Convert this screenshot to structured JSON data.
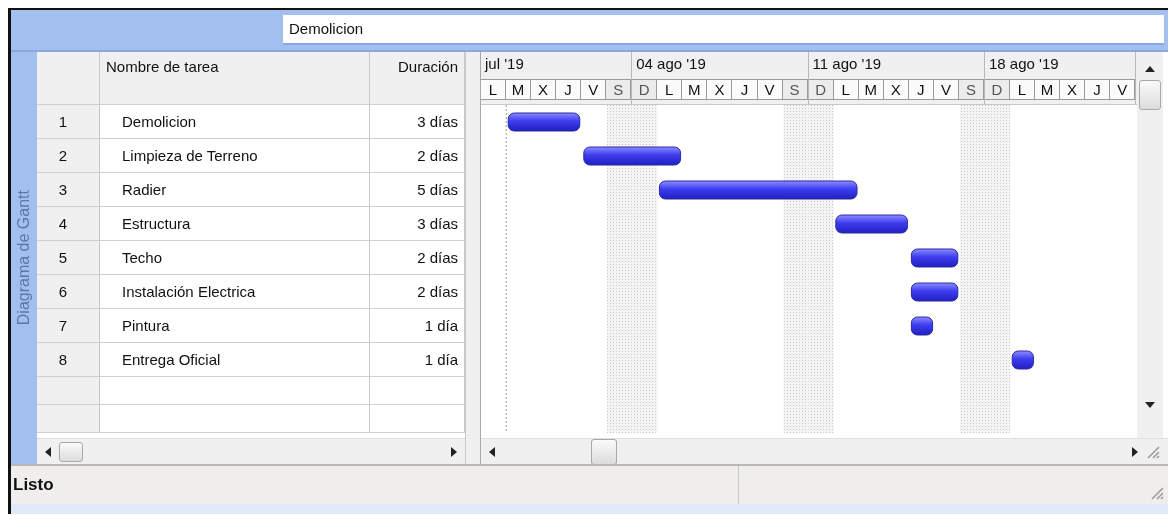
{
  "entry_bar": {
    "value": "Demolicion"
  },
  "side_label": "Diagrama de Gantt",
  "table": {
    "columns": [
      {
        "label": "Nombre de tarea"
      },
      {
        "label": "Duración"
      }
    ],
    "rows": [
      {
        "id": "1",
        "name": "Demolicion",
        "duration": "3 días"
      },
      {
        "id": "2",
        "name": "Limpieza de Terreno",
        "duration": "2 días"
      },
      {
        "id": "3",
        "name": "Radier",
        "duration": "5 días"
      },
      {
        "id": "4",
        "name": "Estructura",
        "duration": "3 días"
      },
      {
        "id": "5",
        "name": "Techo",
        "duration": "2 días"
      },
      {
        "id": "6",
        "name": "Instalación Electrica",
        "duration": "2 días"
      },
      {
        "id": "7",
        "name": "Pintura",
        "duration": "1 día"
      },
      {
        "id": "8",
        "name": "Entrega Oficial",
        "duration": "1 día"
      }
    ]
  },
  "timeline": {
    "weeks": [
      {
        "label": "jul '19",
        "days": [
          {
            "label": "L",
            "nonworking": false
          },
          {
            "label": "M",
            "nonworking": false
          },
          {
            "label": "X",
            "nonworking": false
          },
          {
            "label": "J",
            "nonworking": false
          },
          {
            "label": "V",
            "nonworking": false
          },
          {
            "label": "S",
            "nonworking": true
          }
        ]
      },
      {
        "label": "04 ago '19",
        "days": [
          {
            "label": "D",
            "nonworking": true
          },
          {
            "label": "L",
            "nonworking": false
          },
          {
            "label": "M",
            "nonworking": false
          },
          {
            "label": "X",
            "nonworking": false
          },
          {
            "label": "J",
            "nonworking": false
          },
          {
            "label": "V",
            "nonworking": false
          },
          {
            "label": "S",
            "nonworking": true
          }
        ]
      },
      {
        "label": "11 ago '19",
        "days": [
          {
            "label": "D",
            "nonworking": true
          },
          {
            "label": "L",
            "nonworking": false
          },
          {
            "label": "M",
            "nonworking": false
          },
          {
            "label": "X",
            "nonworking": false
          },
          {
            "label": "J",
            "nonworking": false
          },
          {
            "label": "V",
            "nonworking": false
          },
          {
            "label": "S",
            "nonworking": true
          }
        ]
      },
      {
        "label": "18 ago '19",
        "days": [
          {
            "label": "D",
            "nonworking": true
          },
          {
            "label": "L",
            "nonworking": false
          },
          {
            "label": "M",
            "nonworking": false
          },
          {
            "label": "X",
            "nonworking": false
          },
          {
            "label": "J",
            "nonworking": false
          },
          {
            "label": "V",
            "nonworking": false
          }
        ]
      }
    ]
  },
  "status_bar": {
    "text": "Listo"
  }
}
